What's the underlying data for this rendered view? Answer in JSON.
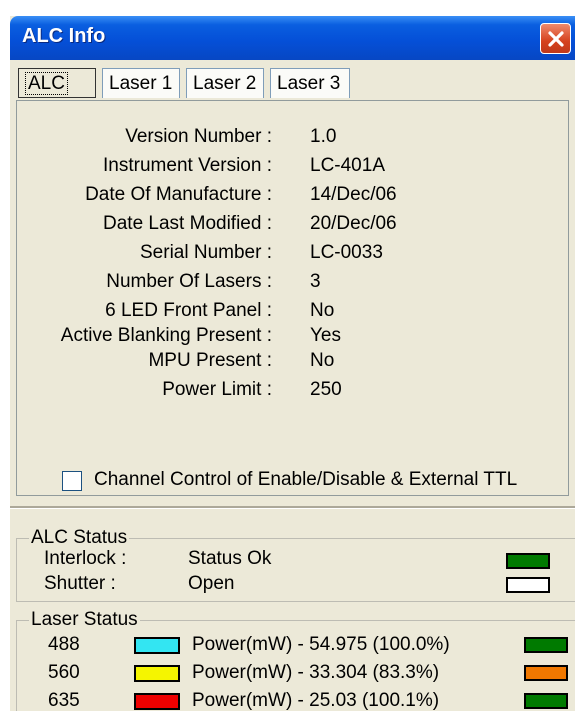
{
  "window": {
    "title": "ALC Info"
  },
  "tabs": [
    {
      "label": "ALC",
      "active": true
    },
    {
      "label": "Laser 1"
    },
    {
      "label": "Laser 2"
    },
    {
      "label": "Laser 3"
    }
  ],
  "info": {
    "fields": [
      {
        "label": "Version Number :",
        "value": "1.0"
      },
      {
        "label": "Instrument Version :",
        "value": "LC-401A"
      },
      {
        "label": "Date Of Manufacture :",
        "value": "14/Dec/06"
      },
      {
        "label": "Date Last Modified :",
        "value": "20/Dec/06"
      },
      {
        "label": "Serial Number :",
        "value": "LC-0033"
      },
      {
        "label": "Number Of Lasers :",
        "value": "3"
      },
      {
        "label": "6 LED Front Panel :",
        "value": "No"
      },
      {
        "label": "Active Blanking Present :",
        "value": "Yes"
      },
      {
        "label": "MPU Present :",
        "value": "No"
      },
      {
        "label": "Power Limit :",
        "value": "250"
      }
    ]
  },
  "channel_control": {
    "label": "Channel Control of Enable/Disable & External TTL",
    "checked": false
  },
  "alc_status": {
    "title": "ALC Status",
    "rows": [
      {
        "label": "Interlock :",
        "value": "Status Ok",
        "indicator_color": "#007a00"
      },
      {
        "label": "Shutter :",
        "value": "Open",
        "indicator_color": "#ffffff"
      }
    ]
  },
  "laser_status": {
    "title": "Laser Status",
    "rows": [
      {
        "wavelength": "488",
        "color": "#33e5f2",
        "power": "Power(mW) - 54.975 (100.0%)",
        "indicator_color": "#007a00"
      },
      {
        "wavelength": "560",
        "color": "#f5f500",
        "power": "Power(mW) - 33.304 (83.3%)",
        "indicator_color": "#f07800"
      },
      {
        "wavelength": "635",
        "color": "#ee0000",
        "power": "Power(mW) - 25.03 (100.1%)",
        "indicator_color": "#007a00"
      }
    ]
  }
}
